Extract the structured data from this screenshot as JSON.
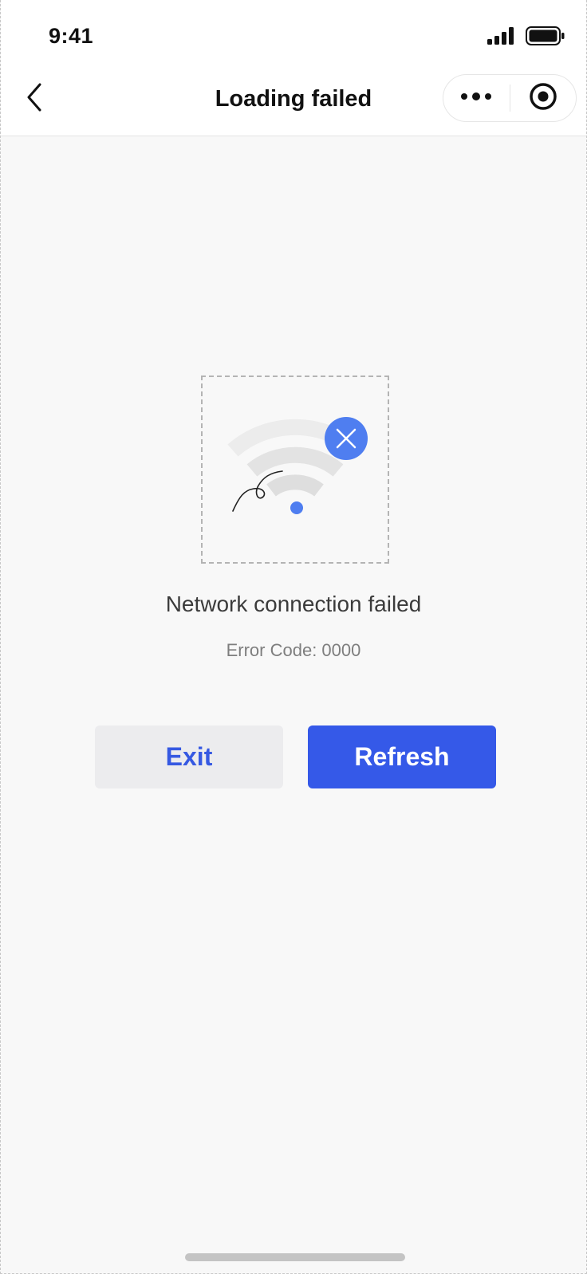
{
  "status_bar": {
    "time": "9:41",
    "signal_icon": "cellular-signal-icon",
    "battery_icon": "battery-icon"
  },
  "nav": {
    "title": "Loading failed",
    "back_icon": "chevron-left-icon",
    "more_icon": "more-dots-icon",
    "close_icon": "target-circle-icon"
  },
  "content": {
    "illustration_icon": "wifi-error-icon",
    "headline": "Network connection failed",
    "error_code": "Error Code: 0000"
  },
  "buttons": {
    "exit_label": "Exit",
    "refresh_label": "Refresh"
  },
  "colors": {
    "accent": "#3559e8",
    "accent_text": "#3659e2",
    "secondary_bg": "#ececee",
    "error_badge": "#4f7ef0"
  }
}
